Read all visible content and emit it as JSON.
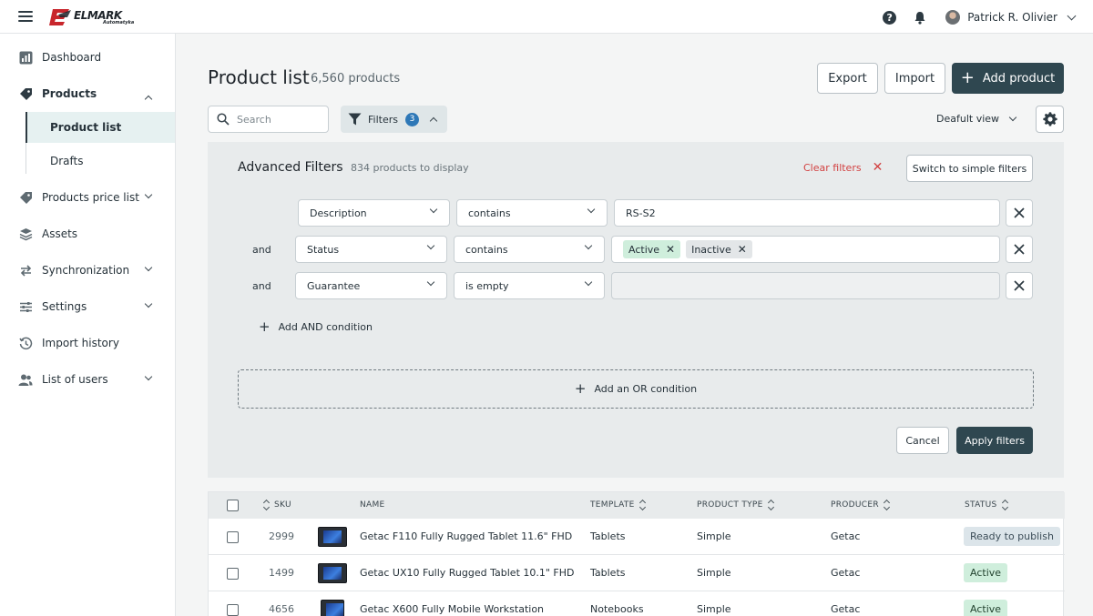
{
  "header": {
    "logo_text": "ELMARK",
    "logo_subtext": "Automatyka",
    "user_name": "Patrick R. Olivier"
  },
  "sidebar": {
    "items": [
      {
        "label": "Dashboard",
        "icon": "chart-icon"
      },
      {
        "label": "Products",
        "icon": "tag-icon",
        "expanded": true
      },
      {
        "label": "Products price list",
        "icon": "tag-icon"
      },
      {
        "label": "Assets",
        "icon": "layers-icon"
      },
      {
        "label": "Synchronization",
        "icon": "sync-icon"
      },
      {
        "label": "Settings",
        "icon": "sliders-icon"
      },
      {
        "label": "Import history",
        "icon": "history-icon"
      },
      {
        "label": "List of users",
        "icon": "users-icon"
      }
    ],
    "sub_items": [
      {
        "label": "Product list",
        "active": true
      },
      {
        "label": "Drafts",
        "active": false
      }
    ]
  },
  "page": {
    "title": "Product list",
    "count": "6,560 products",
    "export_label": "Export",
    "import_label": "Import",
    "add_product_label": "Add product",
    "search_placeholder": "Search",
    "filters_label": "Filters",
    "filters_count": "3",
    "view_label": "Deafult view"
  },
  "advanced_filters": {
    "title": "Advanced Filters",
    "subtitle": "834 products to display",
    "clear_label": "Clear filters",
    "switch_label": "Switch to simple filters",
    "conditions": [
      {
        "connector": "",
        "field": "Description",
        "operator": "contains",
        "value": "RS-S2"
      },
      {
        "connector": "and",
        "field": "Status",
        "operator": "contains",
        "chips": [
          "Active",
          "Inactive"
        ]
      },
      {
        "connector": "and",
        "field": "Guarantee",
        "operator": "is empty",
        "value": ""
      }
    ],
    "add_and_label": "Add AND condition",
    "add_or_label": "Add an OR condition",
    "cancel_label": "Cancel",
    "apply_label": "Apply filters"
  },
  "table": {
    "columns": [
      "SKU",
      "NAME",
      "TEMPLATE",
      "PRODUCT TYPE",
      "PRODUCER",
      "STATUS"
    ],
    "rows": [
      {
        "sku": "2999",
        "name": "Getac F110 Fully Rugged Tablet 11.6\" FHD",
        "template": "Tablets",
        "type": "Simple",
        "producer": "Getac",
        "status": "Ready to publish"
      },
      {
        "sku": "1499",
        "name": "Getac UX10 Fully Rugged Tablet 10.1\" FHD",
        "template": "Tablets",
        "type": "Simple",
        "producer": "Getac",
        "status": "Active"
      },
      {
        "sku": "4656",
        "name": "Getac X600 Fully Mobile Workstation",
        "template": "Notebooks",
        "type": "Simple",
        "producer": "Getac",
        "status": "Active"
      }
    ]
  },
  "colors": {
    "primary": "#2f4750",
    "badge": "#2e78b7",
    "danger": "#d24242",
    "active_chip": "#cfeedc"
  }
}
